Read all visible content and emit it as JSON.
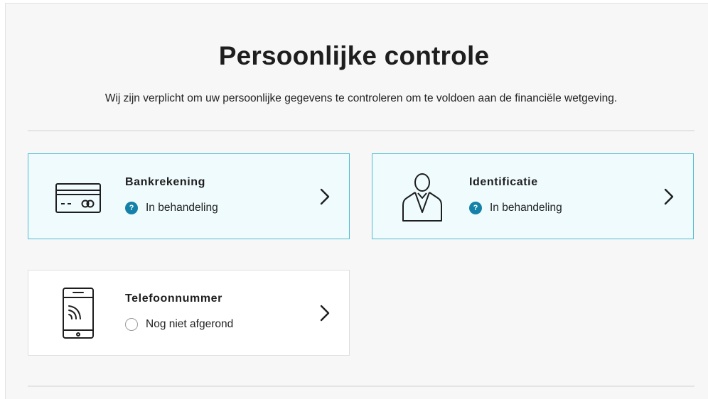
{
  "page": {
    "title": "Persoonlijke controle",
    "intro": "Wij zijn verplicht om uw persoonlijke gegevens te controleren om te voldoen aan de financiële wetgeving."
  },
  "cards": [
    {
      "title": "Bankrekening",
      "status": "In behandeling",
      "status_icon": "question-badge-icon",
      "icon": "bank-card-icon"
    },
    {
      "title": "Identificatie",
      "status": "In behandeling",
      "status_icon": "question-badge-icon",
      "icon": "person-icon"
    },
    {
      "title": "Telefoonnummer",
      "status": "Nog niet afgerond",
      "status_icon": "empty-circle-icon",
      "icon": "phone-icon"
    }
  ],
  "status_badge_glyph": "?",
  "colors": {
    "pending_border": "#4fbdd3",
    "pending_background": "#f0fbfd",
    "badge": "#1482a8",
    "panel_background": "#f7f7f7"
  }
}
